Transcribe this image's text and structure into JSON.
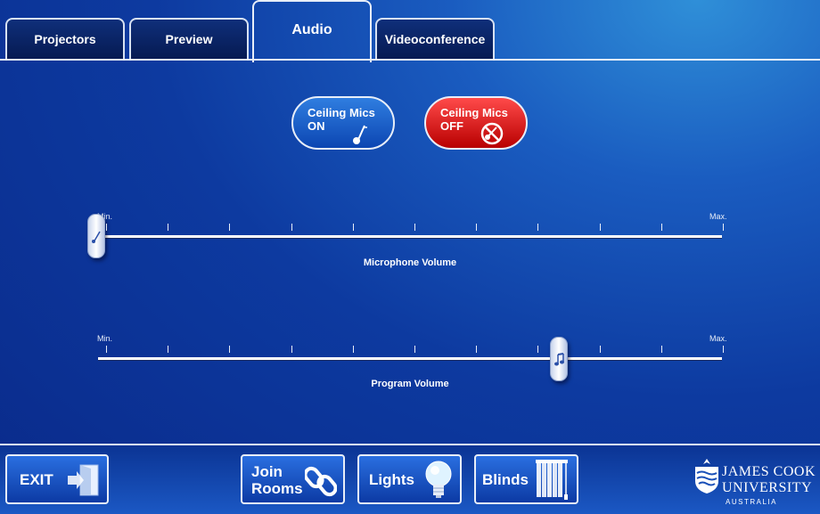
{
  "tabs": {
    "projectors": "Projectors",
    "preview": "Preview",
    "audio": "Audio",
    "videoconference": "Videoconference"
  },
  "mics": {
    "on_line1": "Ceiling Mics",
    "on_line2": "ON",
    "on_icon": "microphone-icon",
    "off_line1": "Ceiling Mics",
    "off_line2": "OFF",
    "off_icon": "microphone-muted-icon"
  },
  "microphone_volume": {
    "title": "Microphone Volume",
    "min_label": "Min.",
    "max_label": "Max.",
    "level_percent": 0,
    "thumb_icon": "microphone-icon"
  },
  "program_volume": {
    "title": "Program Volume",
    "min_label": "Min.",
    "max_label": "Max.",
    "level_percent": 74,
    "thumb_icon": "music-note-icon"
  },
  "bottom": {
    "exit": "EXIT",
    "join_line1": "Join",
    "join_line2": "Rooms",
    "lights": "Lights",
    "blinds": "Blinds"
  },
  "logo": {
    "line1": "JAMES COOK",
    "line2": "UNIVERSITY",
    "line3": "AUSTRALIA"
  },
  "colors": {
    "mic_on": "#1f62cc",
    "mic_off": "#e01010",
    "background": "#0d3aa0"
  }
}
